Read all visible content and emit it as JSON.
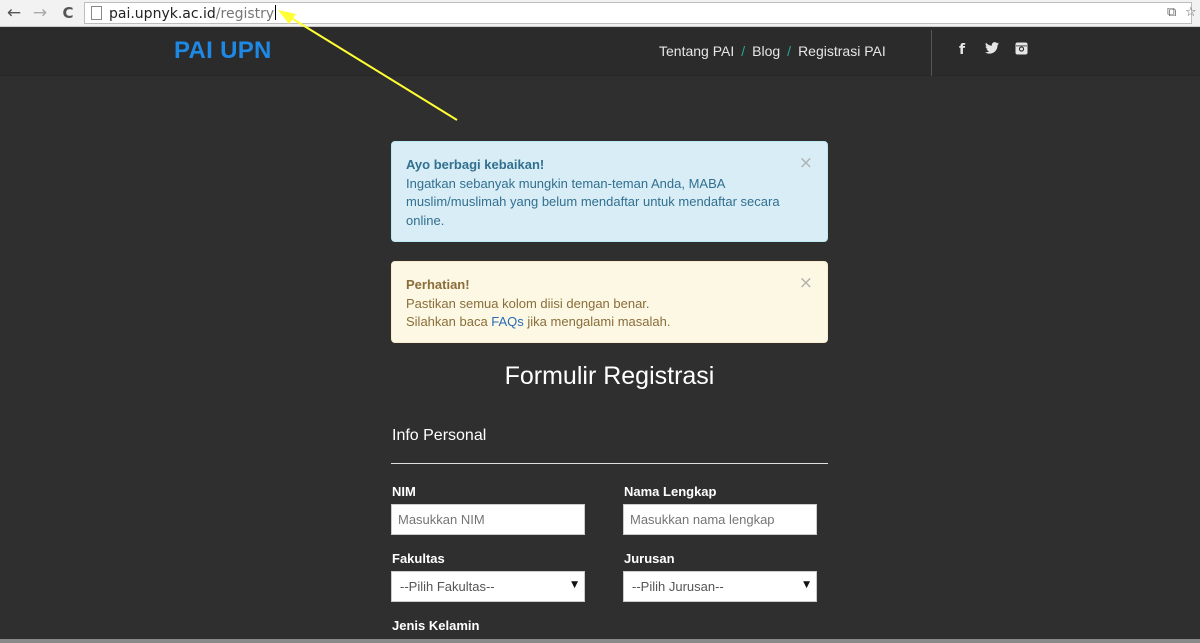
{
  "browser": {
    "back_icon": "←",
    "forward_icon": "→",
    "reload_icon": "C",
    "url_host": "pai.upnyk.ac.id",
    "url_path": "/registry",
    "translate_icon": "⧉",
    "star_icon": "☆",
    "menu_icon": "≡"
  },
  "header": {
    "brand": "PAI UPN",
    "nav": [
      {
        "label": "Tentang PAI"
      },
      {
        "label": "Blog"
      },
      {
        "label": "Registrasi PAI"
      }
    ],
    "separator": "/",
    "social": {
      "facebook": "f",
      "twitter": "t",
      "instagram": "◙"
    }
  },
  "alerts": {
    "info": {
      "title": "Ayo berbagi kebaikan!",
      "body": "Ingatkan sebanyak mungkin teman-teman Anda, MABA muslim/muslimah yang belum mendaftar untuk mendaftar secara online.",
      "close": "×"
    },
    "warning": {
      "title": "Perhatian!",
      "line1": "Pastikan semua kolom diisi dengan benar.",
      "line2_pre": "Silahkan baca ",
      "line2_link": "FAQs",
      "line2_post": " jika mengalami masalah.",
      "close": "×"
    }
  },
  "form": {
    "title": "Formulir Registrasi",
    "section": "Info Personal",
    "nim_label": "NIM",
    "nim_placeholder": "Masukkan NIM",
    "nama_label": "Nama Lengkap",
    "nama_placeholder": "Masukkan nama lengkap",
    "fakultas_label": "Fakultas",
    "fakultas_value": "--Pilih Fakultas--",
    "jurusan_label": "Jurusan",
    "jurusan_value": "--Pilih Jurusan--",
    "gender_label": "Jenis Kelamin",
    "select_arrow": "▼"
  },
  "colors": {
    "brand": "#1e88e5",
    "accent_separator": "#26a69a",
    "annotation_arrow": "#ffff33"
  }
}
